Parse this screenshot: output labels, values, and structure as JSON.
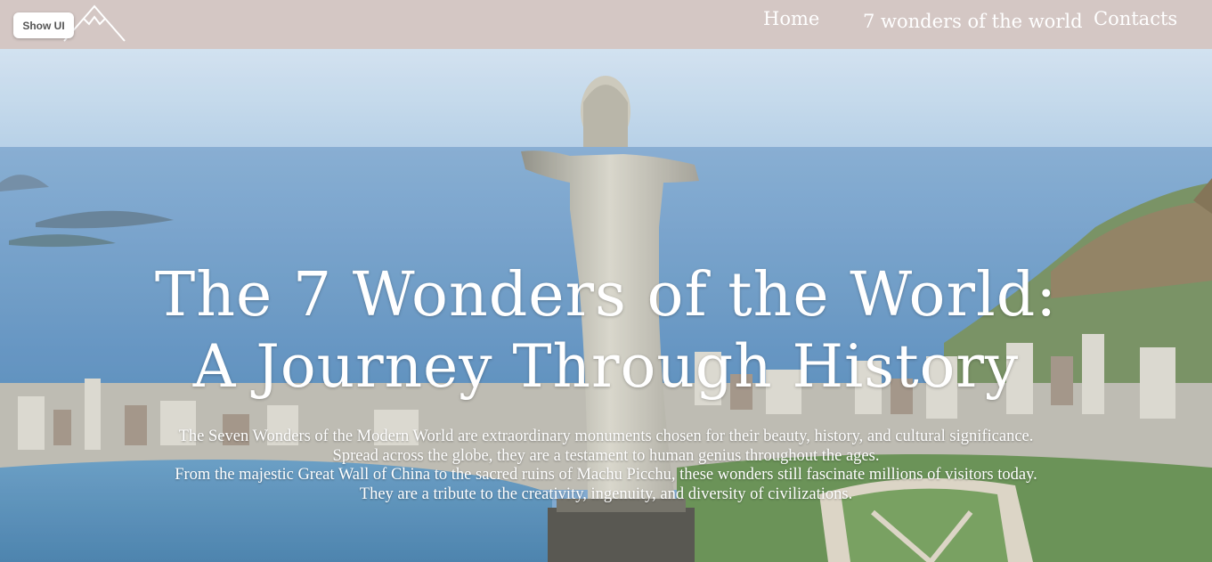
{
  "header": {
    "show_ui_label": "Show UI",
    "nav": [
      {
        "label": "Home"
      },
      {
        "label": "7 wonders of the world"
      },
      {
        "label": "Contacts"
      }
    ]
  },
  "hero": {
    "title_line_1": "The 7 Wonders of the World:",
    "title_line_2": "A Journey Through History",
    "paragraph": [
      "The Seven Wonders of the Modern World are extraordinary monuments chosen for their beauty, history, and cultural significance.",
      "Spread across the globe, they are a testament to human genius throughout the ages.",
      "From the majestic Great Wall of China to the sacred ruins of Machu Picchu, these wonders still fascinate millions of visitors today.",
      "They are a tribute to the creativity, ingenuity, and diversity of civilizations."
    ]
  },
  "colors": {
    "header_bg": "#d4c7c4",
    "text": "#ffffff"
  },
  "icons": {
    "logo": "mountain-icon"
  }
}
